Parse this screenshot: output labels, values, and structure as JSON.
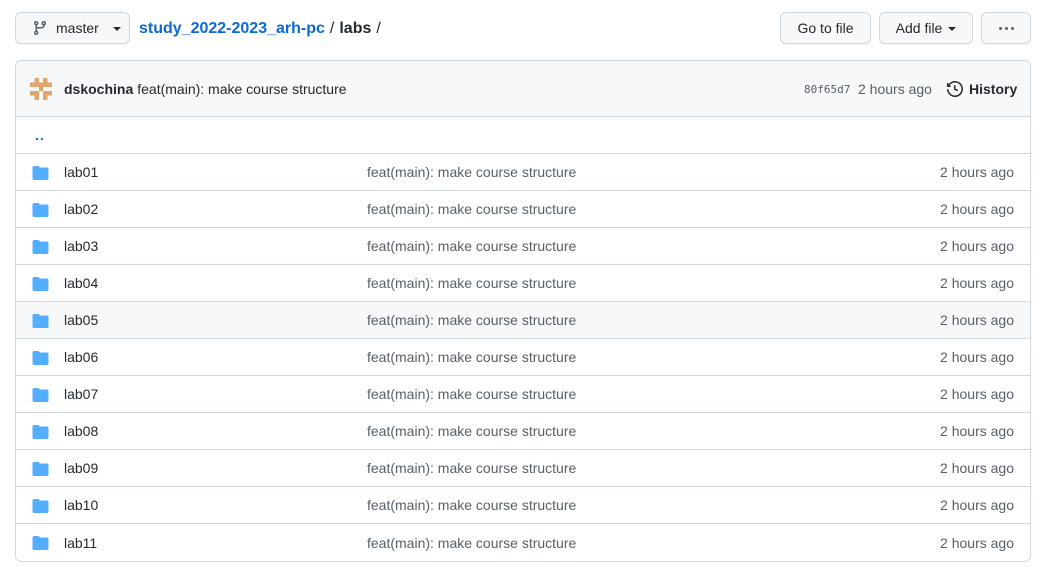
{
  "toolbar": {
    "branch": "master",
    "go_to_file": "Go to file",
    "add_file": "Add file"
  },
  "breadcrumb": {
    "repo": "study_2022-2023_arh-pc",
    "separator": "/",
    "current": "labs",
    "trailing": "/"
  },
  "commit": {
    "author": "dskochina",
    "message": "feat(main): make course structure",
    "sha": "80f65d7",
    "time": "2 hours ago",
    "history_label": "History"
  },
  "parent_link": "..",
  "files": [
    {
      "name": "lab01",
      "message": "feat(main): make course structure",
      "time": "2 hours ago"
    },
    {
      "name": "lab02",
      "message": "feat(main): make course structure",
      "time": "2 hours ago"
    },
    {
      "name": "lab03",
      "message": "feat(main): make course structure",
      "time": "2 hours ago"
    },
    {
      "name": "lab04",
      "message": "feat(main): make course structure",
      "time": "2 hours ago"
    },
    {
      "name": "lab05",
      "message": "feat(main): make course structure",
      "time": "2 hours ago"
    },
    {
      "name": "lab06",
      "message": "feat(main): make course structure",
      "time": "2 hours ago"
    },
    {
      "name": "lab07",
      "message": "feat(main): make course structure",
      "time": "2 hours ago"
    },
    {
      "name": "lab08",
      "message": "feat(main): make course structure",
      "time": "2 hours ago"
    },
    {
      "name": "lab09",
      "message": "feat(main): make course structure",
      "time": "2 hours ago"
    },
    {
      "name": "lab10",
      "message": "feat(main): make course structure",
      "time": "2 hours ago"
    },
    {
      "name": "lab11",
      "message": "feat(main): make course structure",
      "time": "2 hours ago"
    }
  ],
  "icons": {
    "branch": "git-branch-icon",
    "more": "kebab-horizontal-icon",
    "history": "history-icon",
    "folder": "folder-icon",
    "avatar": "identicon-avatar"
  },
  "colors": {
    "link": "#0969da",
    "folder": "#54aeff",
    "muted": "#57606a",
    "avatar": "#e0a66c"
  }
}
